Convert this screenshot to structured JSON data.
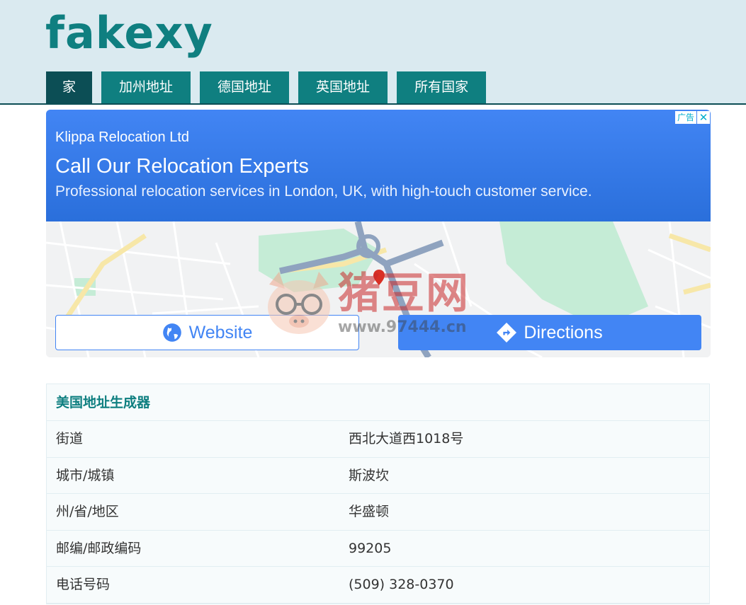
{
  "site": {
    "logo": "fakexy"
  },
  "nav": [
    {
      "label": "家",
      "active": true
    },
    {
      "label": "加州地址",
      "active": false
    },
    {
      "label": "德国地址",
      "active": false
    },
    {
      "label": "英国地址",
      "active": false
    },
    {
      "label": "所有国家",
      "active": false
    }
  ],
  "ad": {
    "company": "Klippa Relocation Ltd",
    "headline": "Call Our Relocation Experts",
    "description": "Professional relocation services in London, UK, with high-touch customer service.",
    "badge": "广告",
    "close": "✕",
    "website_label": "Website",
    "directions_label": "Directions"
  },
  "watermark": {
    "text": "猪豆网",
    "url": "www.97444.cn"
  },
  "address_table": {
    "title": "美国地址生成器",
    "rows": [
      {
        "key": "街道",
        "value": "西北大道西1018号"
      },
      {
        "key": "城市/城镇",
        "value": "斯波坎"
      },
      {
        "key": "州/省/地区",
        "value": "华盛顿"
      },
      {
        "key": "邮编/邮政编码",
        "value": "99205"
      },
      {
        "key": "电话号码",
        "value": "(509) 328-0370"
      }
    ]
  },
  "colors": {
    "teal": "#0f7f80",
    "dark_teal": "#0c4e55",
    "header_bg": "#daeaf0",
    "ad_blue": "#4285f4"
  }
}
